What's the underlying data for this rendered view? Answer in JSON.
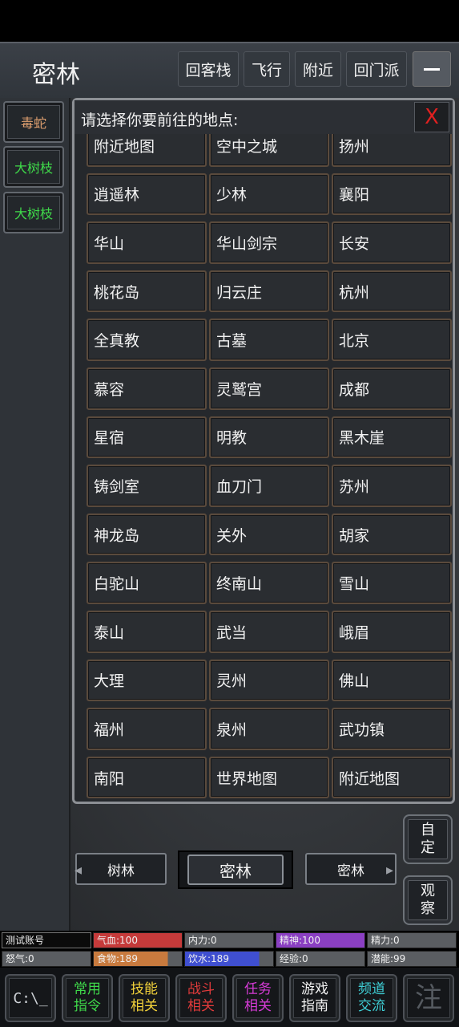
{
  "header": {
    "location": "密林",
    "buttons": [
      "回客栈",
      "飞行",
      "附近",
      "回门派"
    ]
  },
  "npcs": [
    {
      "label": "毒蛇",
      "color": "#e0a070"
    },
    {
      "label": "大树枝",
      "color": "#3fd94a"
    },
    {
      "label": "大树枝",
      "color": "#3fd94a"
    }
  ],
  "dialog": {
    "title": "请选择你要前往的地点:",
    "close": "X",
    "destinations": [
      "附近地图",
      "空中之城",
      "扬州",
      "逍遥林",
      "少林",
      "襄阳",
      "华山",
      "华山剑宗",
      "长安",
      "桃花岛",
      "归云庄",
      "杭州",
      "全真教",
      "古墓",
      "北京",
      "慕容",
      "灵鹫宫",
      "成都",
      "星宿",
      "明教",
      "黑木崖",
      "铸剑室",
      "血刀门",
      "苏州",
      "神龙岛",
      "关外",
      "胡家",
      "白驼山",
      "终南山",
      "雪山",
      "泰山",
      "武当",
      "峨眉",
      "大理",
      "灵州",
      "佛山",
      "福州",
      "泉州",
      "武功镇",
      "南阳",
      "世界地图",
      "附近地图"
    ]
  },
  "exits": {
    "west": "树林",
    "current": "密林",
    "east": "密林"
  },
  "side_buttons": [
    "自定",
    "观察"
  ],
  "stats": {
    "row1": [
      {
        "label": "测试账号",
        "bg": "#0b0b0b",
        "fill": 1
      },
      {
        "label": "气血:100",
        "bg": "#c53a3a",
        "fill": 1
      },
      {
        "label": "内力:0",
        "bg": "#5a5d61",
        "fill": 0
      },
      {
        "label": "精神:100",
        "bg": "#8a3fc2",
        "fill": 1
      },
      {
        "label": "精力:0",
        "bg": "#5a5d61",
        "fill": 0
      }
    ],
    "row2": [
      {
        "label": "怒气:0",
        "bg": "#5a5d61",
        "fill": 0
      },
      {
        "label": "食物:189",
        "bg": "#c87a3e",
        "fill": 0.84
      },
      {
        "label": "饮水:189",
        "bg": "#3f4fd0",
        "fill": 0.84
      },
      {
        "label": "经验:0",
        "bg": "#5a5d61",
        "fill": 0
      },
      {
        "label": "潜能:99",
        "bg": "#5a5d61",
        "fill": 0
      }
    ]
  },
  "bottom_nav": [
    {
      "label": "C:\\_",
      "color": "#cfd3d8"
    },
    {
      "label": "常用指令",
      "color": "#3fd94a"
    },
    {
      "label": "技能相关",
      "color": "#f2d13a"
    },
    {
      "label": "战斗相关",
      "color": "#e23b3b"
    },
    {
      "label": "任务相关",
      "color": "#d63bd6"
    },
    {
      "label": "游戏指南",
      "color": "#f2f2f2"
    },
    {
      "label": "频道交流",
      "color": "#3fcfd6"
    },
    {
      "label": "注",
      "color": "#555a60"
    }
  ]
}
